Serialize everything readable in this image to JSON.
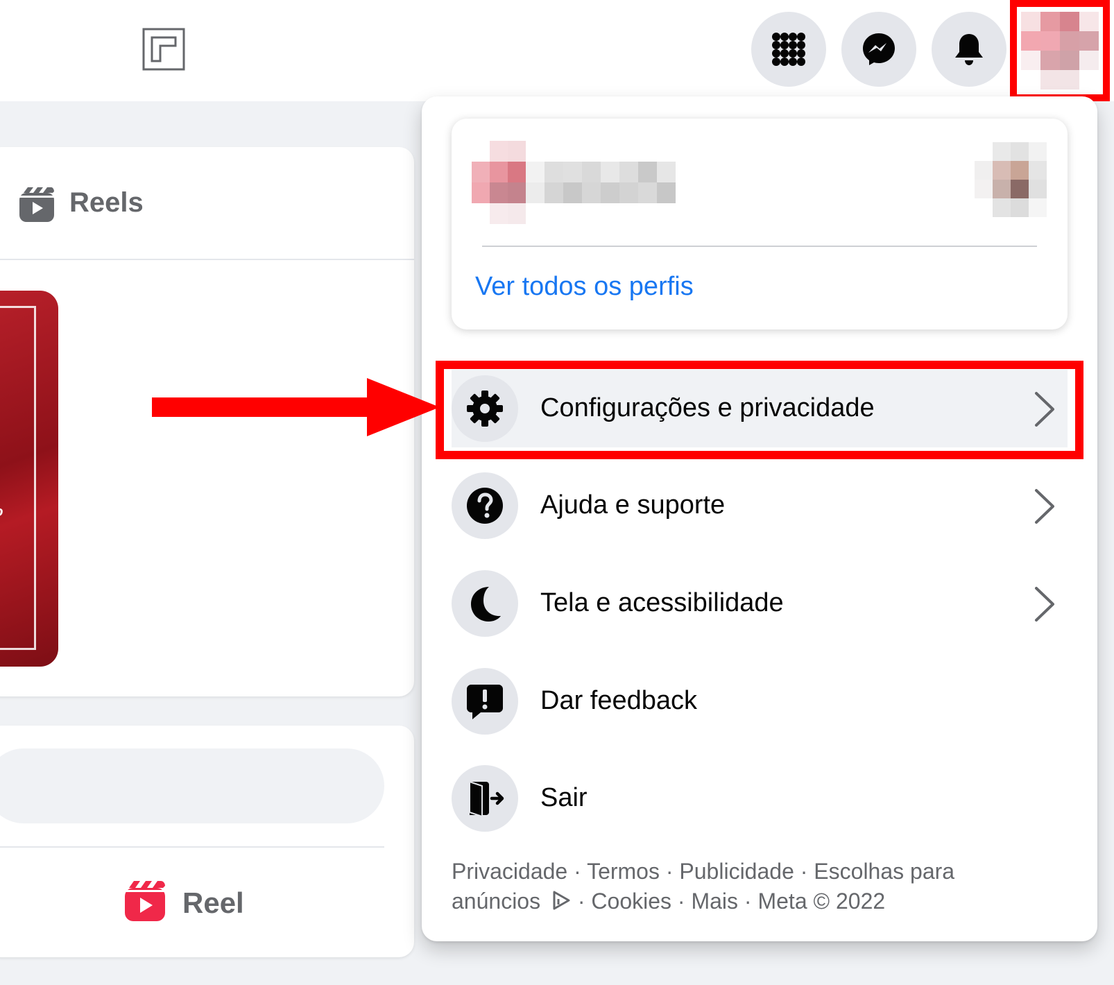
{
  "header": {
    "gaming_icon": "gaming-icon",
    "menu_icon": "grid-menu-icon",
    "messenger_icon": "messenger-icon",
    "notifications_icon": "bell-icon",
    "avatar": "account-avatar"
  },
  "feed": {
    "reels_title": "Reels",
    "create_reel_label": "Reel"
  },
  "menu": {
    "see_all_profiles": "Ver todos os perfis",
    "items": [
      {
        "label": "Configurações e privacidade",
        "icon": "gear-icon",
        "has_submenu": true
      },
      {
        "label": "Ajuda e suporte",
        "icon": "help-icon",
        "has_submenu": true
      },
      {
        "label": "Tela e acessibilidade",
        "icon": "moon-icon",
        "has_submenu": true
      },
      {
        "label": "Dar feedback",
        "icon": "feedback-icon",
        "has_submenu": false
      },
      {
        "label": "Sair",
        "icon": "logout-icon",
        "has_submenu": false
      }
    ],
    "footer": {
      "privacy": "Privacidade",
      "terms": "Termos",
      "advertising": "Publicidade",
      "ad_choices_1": "Escolhas para",
      "ad_choices_2": "anúncios",
      "cookies": "Cookies",
      "more": "Mais",
      "copyright": "Meta © 2022",
      "separator": " · "
    }
  },
  "colors": {
    "accent": "#1877f2",
    "annotation": "#ff0000",
    "secondary_text": "#65676b"
  }
}
